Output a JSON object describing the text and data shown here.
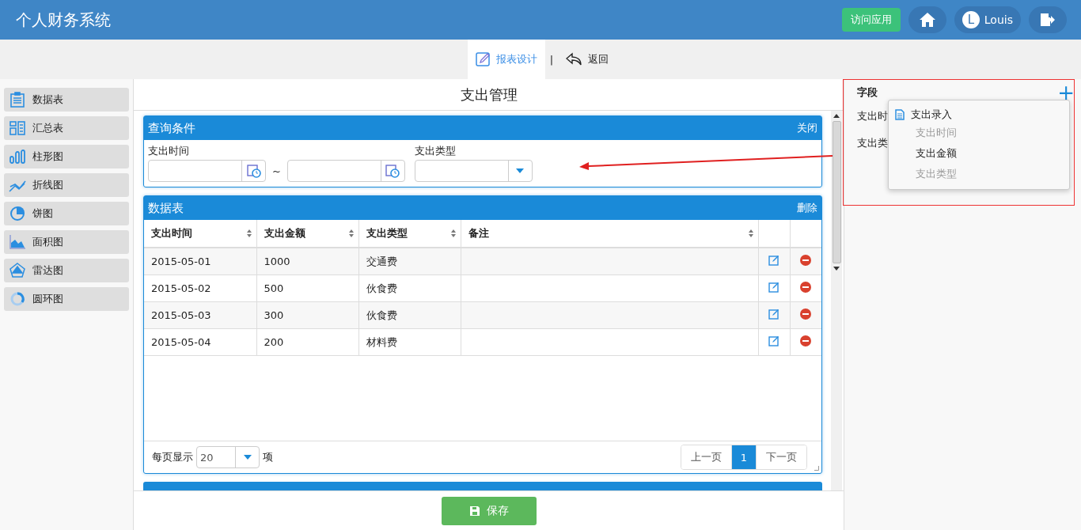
{
  "app": {
    "title": "个人财务系统",
    "buttons": [
      {
        "kind": "visit",
        "label": "访问应用"
      },
      {
        "kind": "home"
      },
      {
        "kind": "user",
        "avatar": "L",
        "label": "Louis"
      },
      {
        "kind": "logout"
      }
    ]
  },
  "toolbar": {
    "tabs": [
      {
        "kind": "design",
        "label": "报表设计",
        "selected": true
      },
      {
        "kind": "back",
        "label": "返回",
        "selected": false
      }
    ],
    "separator": "|"
  },
  "sidebar": {
    "items": [
      {
        "kind": "table",
        "label": "数据表"
      },
      {
        "kind": "summary",
        "label": "汇总表"
      },
      {
        "kind": "bar",
        "label": "柱形图"
      },
      {
        "kind": "line",
        "label": "折线图"
      },
      {
        "kind": "pie",
        "label": "饼图"
      },
      {
        "kind": "area",
        "label": "面积图"
      },
      {
        "kind": "radar",
        "label": "雷达图"
      },
      {
        "kind": "donut",
        "label": "圆环图"
      }
    ]
  },
  "main": {
    "title": "支出管理",
    "query": {
      "title": "查询条件",
      "action": "关闭",
      "date_label": "支出时间",
      "range_separator": "~",
      "type_label": "支出类型"
    },
    "table_panel": {
      "title": "数据表",
      "action": "删除",
      "columns": [
        "支出时间",
        "支出金额",
        "支出类型",
        "备注"
      ],
      "rows": [
        [
          "2015-05-01",
          "1000",
          "交通费",
          ""
        ],
        [
          "2015-05-02",
          "500",
          "伙食费",
          ""
        ],
        [
          "2015-05-03",
          "300",
          "伙食费",
          ""
        ],
        [
          "2015-05-04",
          "200",
          "材料费",
          ""
        ]
      ],
      "page_size_label": "每页显示",
      "page_size": "20",
      "page_size_unit": "项",
      "prev": "上一页",
      "pages": [
        {
          "label": "1",
          "selected": true
        }
      ],
      "next": "下一页"
    },
    "save": "保存"
  },
  "fields_panel": {
    "title": "字段",
    "add": "+",
    "fields": [
      "支出时",
      "支出类"
    ],
    "popup": {
      "title": "支出录入",
      "items": [
        {
          "label": "支出时间",
          "disabled": true
        },
        {
          "label": "支出金额",
          "disabled": false
        },
        {
          "label": "支出类型",
          "disabled": true
        }
      ]
    }
  }
}
